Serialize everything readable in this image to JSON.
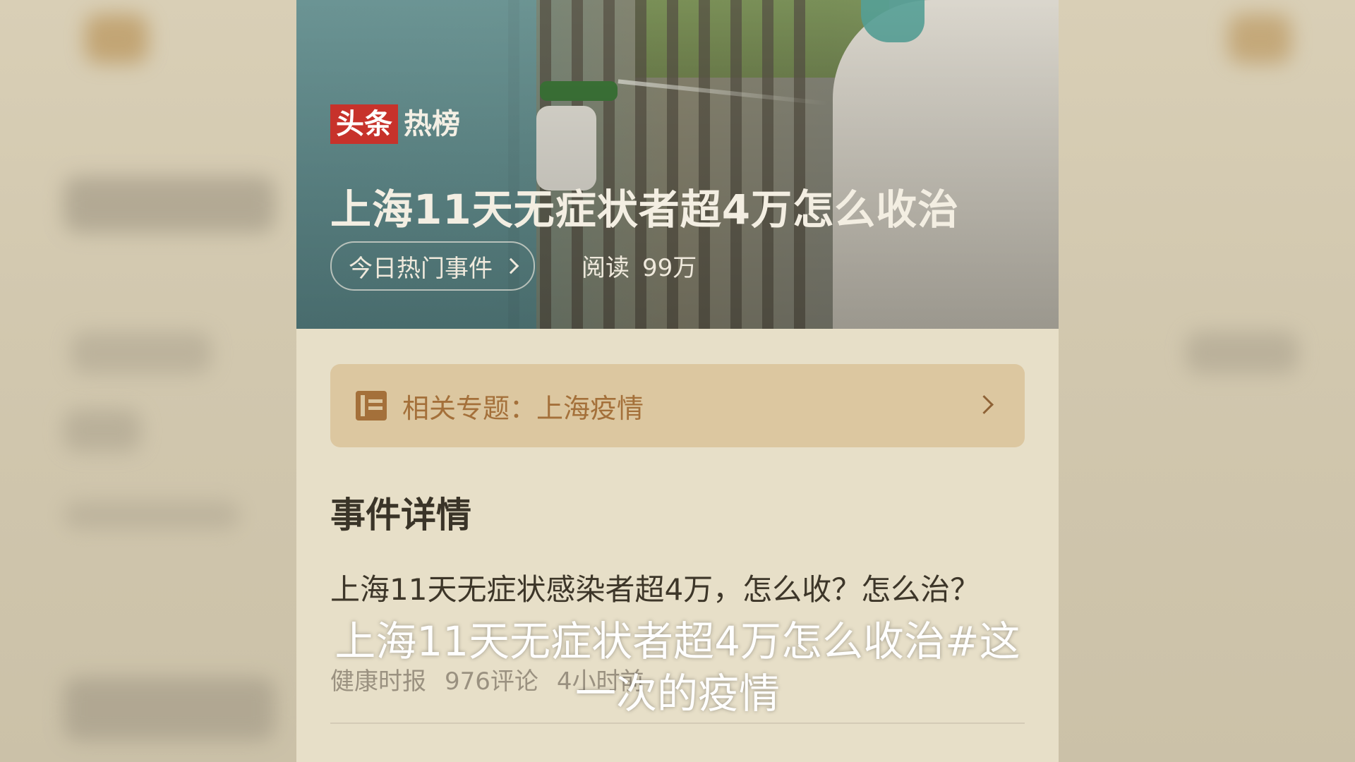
{
  "hero": {
    "brand_part1": "头条",
    "brand_part2": "热榜",
    "headline": "上海11天无症状者超4万怎么收治",
    "tag_label": "今日热门事件",
    "reads_label": "阅读",
    "reads_value": "99万"
  },
  "topic": {
    "label": "相关专题：",
    "value": "上海疫情",
    "icon": "book-icon"
  },
  "section": {
    "title": "事件详情"
  },
  "article": {
    "summary": "上海11天无症状感染者超4万，怎么收？怎么治？",
    "source": "健康时报",
    "comments": "976评论",
    "time": "4小时前"
  },
  "caption": {
    "line1": "上海11天无症状者超4万怎么收治#这",
    "line2": "一次的疫情"
  },
  "colors": {
    "brand_red": "#c7322b",
    "topic_bg": "#dcc7a0",
    "topic_text": "#a4703a",
    "page_bg": "#e7dfc8"
  }
}
